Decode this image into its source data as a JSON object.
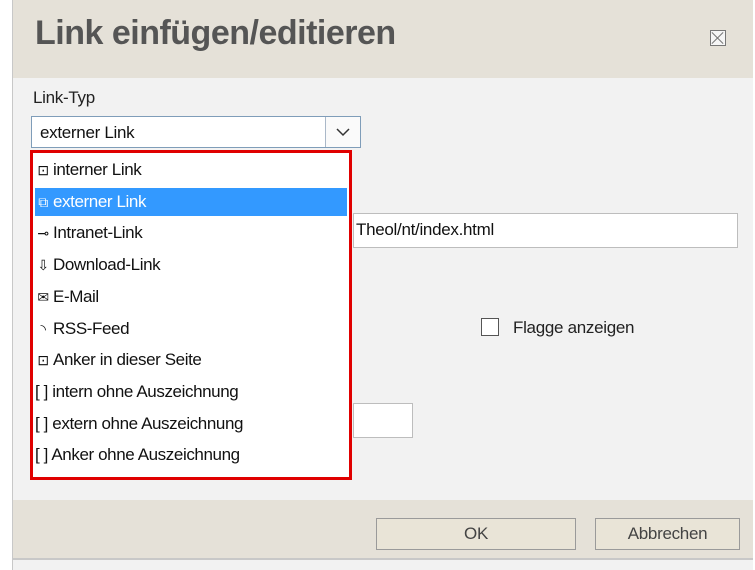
{
  "dialog": {
    "title": "Link einfügen/editieren",
    "close_icon": "close-box-icon"
  },
  "form": {
    "link_type_label": "Link-Typ",
    "link_type_value": "externer Link",
    "url_value": "Theol/nt/index.html",
    "flag_label": "Flagge anzeigen",
    "flag_checked": false
  },
  "dropdown": {
    "highlight_color": "#e00000",
    "selected_color": "#3399ff",
    "items": [
      {
        "label": "interner Link",
        "icon": "arrow-box-icon",
        "glyph": "⊡"
      },
      {
        "label": "externer Link",
        "icon": "external-link-icon",
        "glyph": "⧉"
      },
      {
        "label": "Intranet-Link",
        "icon": "key-icon",
        "glyph": "⊸"
      },
      {
        "label": "Download-Link",
        "icon": "download-icon",
        "glyph": "⇩"
      },
      {
        "label": "E-Mail",
        "icon": "envelope-icon",
        "glyph": "✉"
      },
      {
        "label": "RSS-Feed",
        "icon": "rss-icon",
        "glyph": "◝"
      },
      {
        "label": "Anker in dieser Seite",
        "icon": "anchor-arrow-icon",
        "glyph": "⊡"
      },
      {
        "label": "[ ] intern ohne Auszeichnung",
        "icon": "",
        "glyph": ""
      },
      {
        "label": "[ ] extern ohne Auszeichnung",
        "icon": "",
        "glyph": ""
      },
      {
        "label": "[ ] Anker ohne Auszeichnung",
        "icon": "",
        "glyph": ""
      }
    ],
    "selected_index": 1
  },
  "footer": {
    "ok_label": "OK",
    "cancel_label": "Abbrechen"
  }
}
